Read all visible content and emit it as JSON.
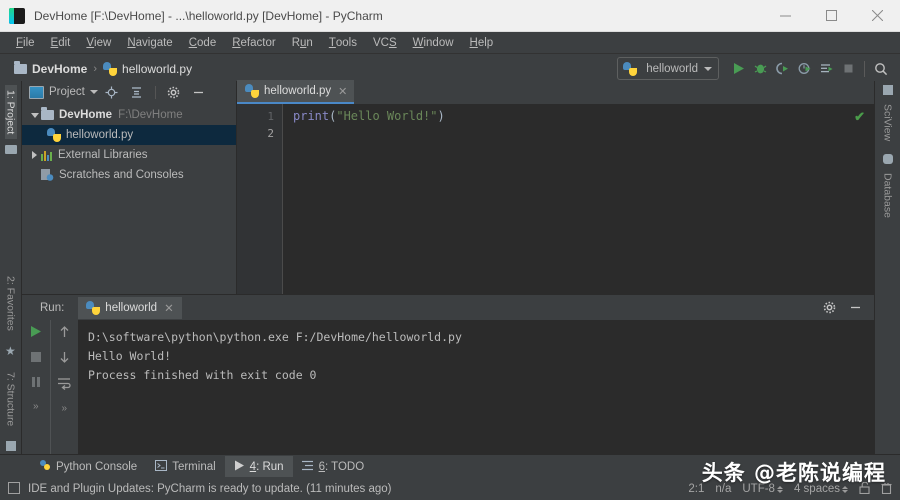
{
  "window": {
    "title": "DevHome [F:\\DevHome] - ...\\helloworld.py [DevHome] - PyCharm",
    "app_icon": "pycharm-logo",
    "minimize_label": "—",
    "maximize_label": "□",
    "close_label": "✕"
  },
  "menubar": {
    "items": [
      {
        "mnemonic": "F",
        "rest": "ile"
      },
      {
        "mnemonic": "E",
        "rest": "dit"
      },
      {
        "mnemonic": "V",
        "rest": "iew"
      },
      {
        "mnemonic": "N",
        "rest": "avigate"
      },
      {
        "mnemonic": "C",
        "rest": "ode"
      },
      {
        "mnemonic": "R",
        "rest": "efactor"
      },
      {
        "mnemonic": "R",
        "rest": "un",
        "prefix": "R",
        "style": "Run"
      },
      {
        "mnemonic": "T",
        "rest": "ools"
      },
      {
        "mnemonic": "S",
        "rest": "VCS"
      },
      {
        "mnemonic": "W",
        "rest": "indow"
      },
      {
        "mnemonic": "H",
        "rest": "elp"
      }
    ],
    "labels": [
      "File",
      "Edit",
      "View",
      "Navigate",
      "Code",
      "Refactor",
      "Run",
      "Tools",
      "VCS",
      "Window",
      "Help"
    ]
  },
  "navbar": {
    "breadcrumb_project": "DevHome",
    "breadcrumb_sep": "›",
    "breadcrumb_file": "helloworld.py",
    "run_config": "helloworld",
    "icons": [
      "run-icon",
      "debug-icon",
      "run-coverage-icon",
      "profile-icon",
      "run-with-console-icon",
      "stop-icon",
      "search-icon"
    ]
  },
  "left_rail": {
    "project": "1: Project",
    "favorites": "2: Favorites",
    "structure": "7: Structure"
  },
  "right_rail": {
    "sciview": "SciView",
    "database": "Database"
  },
  "project_panel": {
    "title": "Project",
    "toolbar_icons": [
      "locate-icon",
      "collapse-all-icon",
      "settings-icon",
      "hide-icon"
    ],
    "tree": [
      {
        "label": "DevHome",
        "path": "F:\\DevHome",
        "icon": "folder-icon",
        "expanded": true,
        "selected": false,
        "depth": 0
      },
      {
        "label": "helloworld.py",
        "path": "",
        "icon": "python-file-icon",
        "expanded": false,
        "selected": true,
        "depth": 1
      },
      {
        "label": "External Libraries",
        "path": "",
        "icon": "library-icon",
        "expanded": false,
        "selected": false,
        "depth": 0
      },
      {
        "label": "Scratches and Consoles",
        "path": "",
        "icon": "scratches-icon",
        "expanded": false,
        "selected": false,
        "depth": 0
      }
    ]
  },
  "editor": {
    "tab_label": "helloworld.py",
    "tab_close": "✕",
    "line_numbers": [
      "1",
      "2"
    ],
    "code_line_1": {
      "fn": "print",
      "paren_open": "(",
      "string": "\"Hello World!\"",
      "paren_close": ")"
    },
    "inspection_status": "✔"
  },
  "run_panel": {
    "label": "Run:",
    "tab_label": "helloworld",
    "tab_close": "✕",
    "header_icons": [
      "settings-icon",
      "hide-icon"
    ],
    "gutter_icons": [
      "rerun-icon",
      "stop-icon",
      "pause-icon",
      "scroll-up-icon",
      "scroll-down-icon",
      "soft-wrap-icon"
    ],
    "gutter_more_left": "»",
    "gutter_more_right": "»",
    "console_lines": [
      "D:\\software\\python\\python.exe F:/DevHome/helloworld.py",
      "Hello World!",
      "",
      "Process finished with exit code 0"
    ]
  },
  "tool_window_bar": {
    "items": [
      {
        "label": "Python Console",
        "mnemonic": "",
        "icon": "python-console-icon",
        "selected": false
      },
      {
        "label": "Terminal",
        "mnemonic": "",
        "icon": "terminal-icon",
        "selected": false
      },
      {
        "label": "4: Run",
        "mnemonic": "4",
        "icon": "run-icon",
        "selected": true
      },
      {
        "label": "6: TODO",
        "mnemonic": "6",
        "icon": "todo-icon",
        "selected": false
      }
    ]
  },
  "statusbar": {
    "message": "IDE and Plugin Updates: PyCharm is ready to update. (11 minutes ago)",
    "caret_position": "2:1",
    "vcs": "n/a",
    "encoding": "UTF-8",
    "indent": "4 spaces",
    "lock_icon": "unlocked-icon",
    "trash_icon": "trash-icon"
  },
  "watermark": {
    "text": "头条 @老陈说编程"
  },
  "colors": {
    "accent_blue": "#4a88c7",
    "selection": "#0d293e",
    "editor_bg": "#2b2b2b",
    "panel_bg": "#3c3f41",
    "string_green": "#6a8759",
    "function_violet": "#8888c6",
    "run_green": "#499c54"
  }
}
